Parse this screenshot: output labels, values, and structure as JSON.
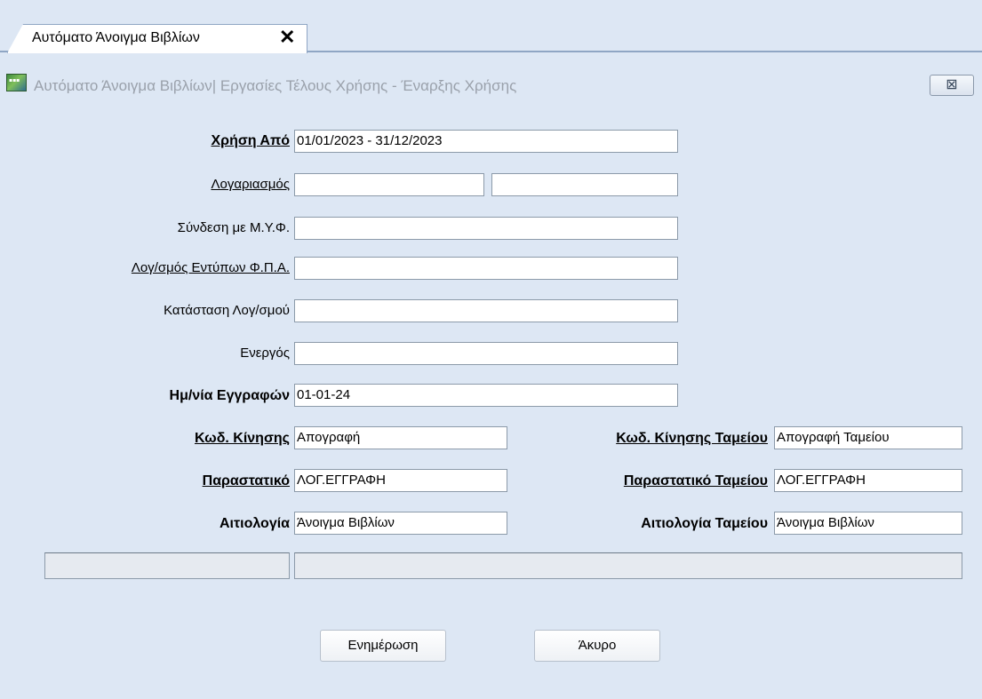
{
  "tab": {
    "label": "Αυτόματο Άνοιγμα Βιβλίων",
    "close": "✕"
  },
  "window": {
    "title": "Αυτόματο Άνοιγμα Βιβλίων| Εργασίες Τέλους Χρήσης - Έναρξης Χρήσης",
    "close_glyph": "⊠"
  },
  "form": {
    "fiscal_year": {
      "label": "Χρήση Από",
      "value": "01/01/2023 - 31/12/2023"
    },
    "account": {
      "label": "Λογαριασμός",
      "value_from": "",
      "value_to": ""
    },
    "myf_link": {
      "label": "Σύνδεση με Μ.Υ.Φ.",
      "value": ""
    },
    "vat_forms_account": {
      "label": "Λογ/σμός Εντύπων Φ.Π.Α.",
      "value": ""
    },
    "account_status": {
      "label": "Κατάσταση Λογ/σμού",
      "value": ""
    },
    "active": {
      "label": "Ενεργός",
      "value": ""
    },
    "entries_date": {
      "label": "Ημ/νία Εγγραφών",
      "value": "01-01-24"
    },
    "movement_code": {
      "label": "Κωδ. Κίνησης",
      "value": "Απογραφή"
    },
    "cash_movement_code": {
      "label": "Κωδ. Κίνησης Ταμείου",
      "value": "Απογραφή Ταμείου"
    },
    "document": {
      "label": "Παραστατικό",
      "value": "ΛΟΓ.ΕΓΓΡΑΦΗ"
    },
    "cash_document": {
      "label": "Παραστατικό Ταμείου",
      "value": "ΛΟΓ.ΕΓΓΡΑΦΗ"
    },
    "reason": {
      "label": "Αιτιολογία",
      "value": "Άνοιγμα Βιβλίων"
    },
    "cash_reason": {
      "label": "Αιτιολογία Ταμείου",
      "value": "Άνοιγμα Βιβλίων"
    }
  },
  "buttons": {
    "update": "Ενημέρωση",
    "cancel": "Άκυρο"
  }
}
